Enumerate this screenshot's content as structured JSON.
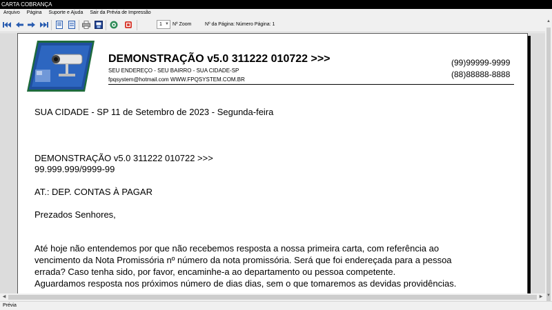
{
  "window": {
    "title": "CARTA COBRANÇA"
  },
  "menu": [
    "Arquivo",
    "Página",
    "Suporte e Ajuda",
    "Sair da Prévia de Impressão"
  ],
  "toolbar": {
    "zoom_value": "1",
    "zoom_label": "Nº Zoom",
    "page_info": "Nº da Página: Número Página: 1"
  },
  "letter": {
    "company": "DEMONSTRAÇÃO v5.0 311222 010722 >>>",
    "address": "SEU ENDEREÇO - SEU BAIRRO - SUA CIDADE-SP",
    "contacts": "fpqsystem@hotmail.com  WWW.FPQSYSTEM.COM.BR",
    "phone1": "(99)99999-9999",
    "phone2": "(88)88888-8888",
    "date_line": "SUA CIDADE - SP 11 de Setembro de 2023 - Segunda-feira",
    "recipient_name": "DEMONSTRAÇÃO v5.0 311222 010722 >>>",
    "recipient_doc": "99.999.999/9999-99",
    "attention": "AT.: DEP. CONTAS À PAGAR",
    "greeting": "Prezados Senhores,",
    "paragraph_lines": [
      "Até hoje não entendemos por que não recebemos resposta a nossa primeira carta, com referência ao",
      "vencimento da Nota Promissória nº número da nota promissória. Será que foi endereçada para a pessoa",
      "errada? Caso tenha sido, por favor, encaminhe-a ao departamento ou pessoa competente.",
      "Aguardamos resposta nos próximos número de dias dias, sem o que tomaremos as devidas providências."
    ]
  },
  "status": {
    "text": "Prévia"
  },
  "colors": {
    "titlebar": "#000000",
    "accent_blue": "#1f4f9e",
    "logo_green": "#1e6b3c"
  }
}
